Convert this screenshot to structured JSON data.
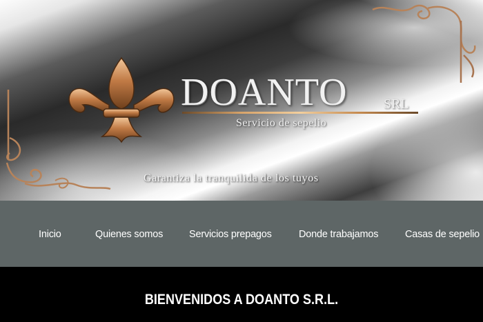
{
  "hero": {
    "logo_name": "DOANTO",
    "logo_suffix": "SRL",
    "subtitle": "Servicio de sepelio",
    "tagline": "Garantiza la tranquilida de los tuyos",
    "emblem_icon": "fleur-de-lis-icon",
    "accent_color": "#c8895a"
  },
  "nav": {
    "background": "#5e6666",
    "items": [
      {
        "label": "Inicio"
      },
      {
        "label": "Quienes somos"
      },
      {
        "label": "Servicios prepagos"
      },
      {
        "label": "Donde trabajamos"
      },
      {
        "label": "Casas de sepelio"
      }
    ]
  },
  "welcome": {
    "title": "BIENVENIDOS A DOANTO S.R.L."
  }
}
